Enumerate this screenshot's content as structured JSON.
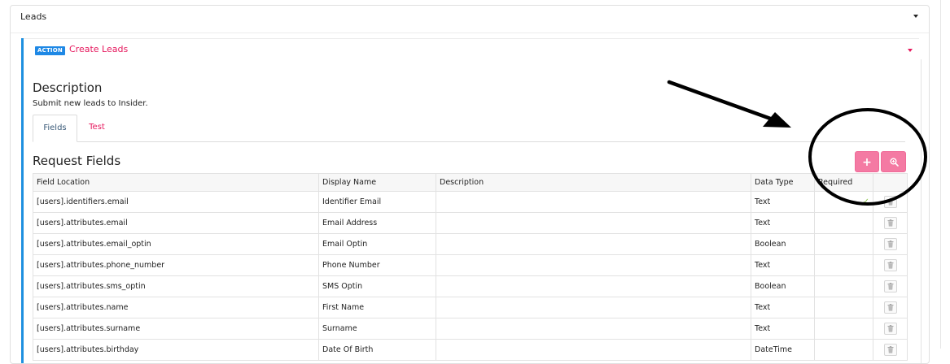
{
  "panel": {
    "title": "Leads"
  },
  "action": {
    "badge": "ACTION",
    "title": "Create Leads",
    "description_heading": "Description",
    "description_text": "Submit new leads to Insider."
  },
  "tabs": [
    {
      "label": "Fields",
      "active": true
    },
    {
      "label": "Test",
      "active": false
    }
  ],
  "request_fields": {
    "heading": "Request Fields",
    "add_button": "+",
    "columns": [
      "Field Location",
      "Display Name",
      "Description",
      "Data Type",
      "Required",
      ""
    ],
    "rows": [
      {
        "location": "[users].identifiers.email",
        "display": "Identifier Email",
        "description": "",
        "type": "Text",
        "required": true
      },
      {
        "location": "[users].attributes.email",
        "display": "Email Address",
        "description": "",
        "type": "Text",
        "required": false
      },
      {
        "location": "[users].attributes.email_optin",
        "display": "Email Optin",
        "description": "",
        "type": "Boolean",
        "required": false
      },
      {
        "location": "[users].attributes.phone_number",
        "display": "Phone Number",
        "description": "",
        "type": "Text",
        "required": false
      },
      {
        "location": "[users].attributes.sms_optin",
        "display": "SMS Optin",
        "description": "",
        "type": "Boolean",
        "required": false
      },
      {
        "location": "[users].attributes.name",
        "display": "First Name",
        "description": "",
        "type": "Text",
        "required": false
      },
      {
        "location": "[users].attributes.surname",
        "display": "Surname",
        "description": "",
        "type": "Text",
        "required": false
      },
      {
        "location": "[users].attributes.birthday",
        "display": "Date Of Birth",
        "description": "",
        "type": "DateTime",
        "required": false
      }
    ]
  },
  "colors": {
    "accent": "#e6195e",
    "badge": "#1e88e5",
    "action_border": "#1e90e0",
    "button_pink": "#f47aa3"
  }
}
